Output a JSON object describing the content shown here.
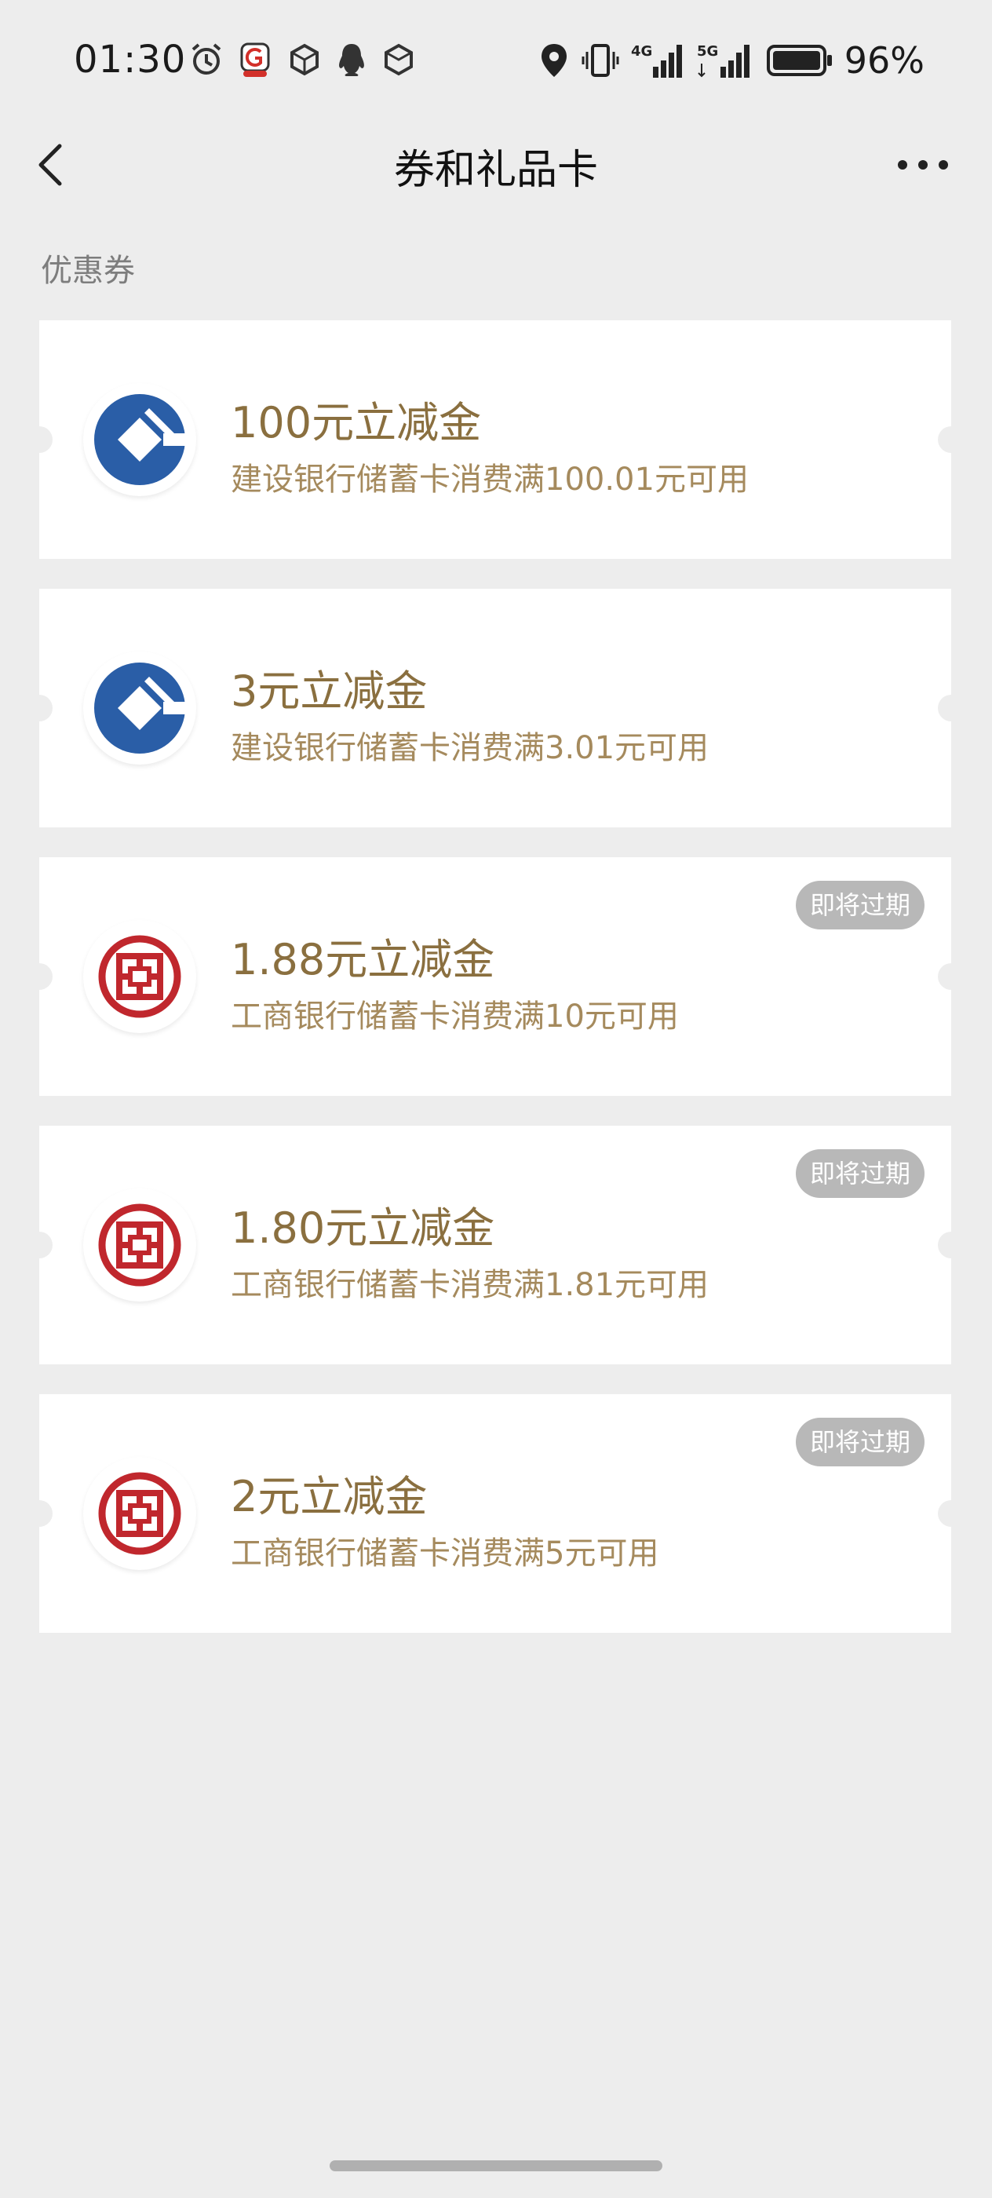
{
  "status_bar": {
    "time": "01:30",
    "battery": "96%",
    "left_icons": [
      "alarm-icon",
      "app-badge-icon",
      "box-icon",
      "qq-icon",
      "box-icon"
    ],
    "right_icons": [
      "location-icon",
      "vibrate-icon",
      "signal-4g-icon",
      "signal-5g-icon",
      "battery-icon"
    ],
    "network_4g": "4G",
    "network_5g": "5G"
  },
  "nav": {
    "title": "券和礼品卡",
    "back_icon": "chevron-left-icon",
    "more_icon": "more-dots-icon"
  },
  "section": {
    "title": "优惠券"
  },
  "colors": {
    "ccb_blue": "#2a5ea7",
    "icbc_red": "#c0272d",
    "coupon_title": "#8a6f3f",
    "coupon_desc": "#a58a5d",
    "badge_bg": "#b8b8b8"
  },
  "coupons": [
    {
      "bank": "ccb",
      "title": "100元立减金",
      "desc": "建设银行储蓄卡消费满100.01元可用",
      "badge": ""
    },
    {
      "bank": "ccb",
      "title": "3元立减金",
      "desc": "建设银行储蓄卡消费满3.01元可用",
      "badge": ""
    },
    {
      "bank": "icbc",
      "title": "1.88元立减金",
      "desc": "工商银行储蓄卡消费满10元可用",
      "badge": "即将过期"
    },
    {
      "bank": "icbc",
      "title": "1.80元立减金",
      "desc": "工商银行储蓄卡消费满1.81元可用",
      "badge": "即将过期"
    },
    {
      "bank": "icbc",
      "title": "2元立减金",
      "desc": "工商银行储蓄卡消费满5元可用",
      "badge": "即将过期"
    }
  ]
}
